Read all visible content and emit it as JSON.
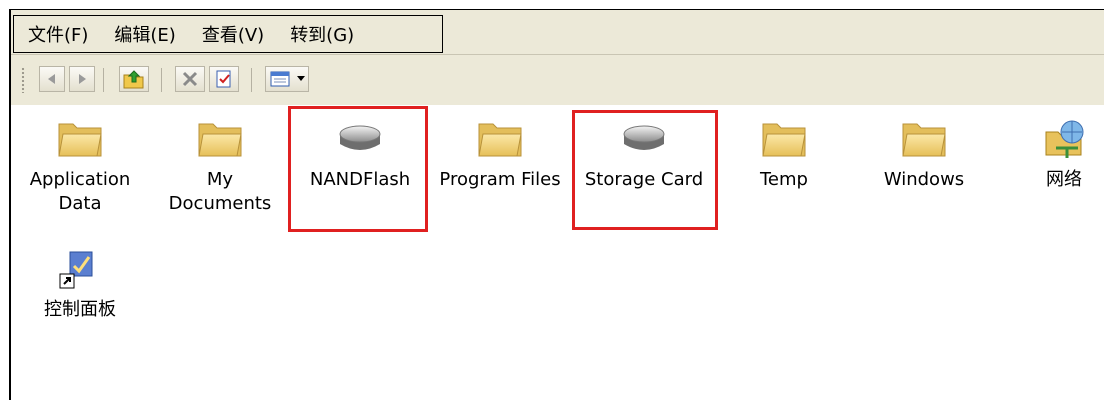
{
  "menu": {
    "file": "文件(F)",
    "edit": "编辑(E)",
    "view": "查看(V)",
    "goto": "转到(G)"
  },
  "toolbar": {
    "icons": [
      "back-icon",
      "forward-icon",
      "up-folder-icon",
      "delete-icon",
      "properties-icon",
      "view-mode-icon",
      "dropdown-arrow-icon"
    ]
  },
  "items": [
    {
      "name": "Application Data",
      "line1": "Application",
      "line2": "Data",
      "icon": "folder-icon"
    },
    {
      "name": "My Documents",
      "line1": "My",
      "line2": "Documents",
      "icon": "folder-icon"
    },
    {
      "name": "NANDFlash",
      "line1": "NANDFlash",
      "line2": "",
      "icon": "drive-icon",
      "highlighted": true
    },
    {
      "name": "Program Files",
      "line1": "Program Files",
      "line2": "",
      "icon": "folder-icon"
    },
    {
      "name": "Storage Card",
      "line1": "Storage Card",
      "line2": "",
      "icon": "drive-icon",
      "highlighted": true
    },
    {
      "name": "Temp",
      "line1": "Temp",
      "line2": "",
      "icon": "folder-icon"
    },
    {
      "name": "Windows",
      "line1": "Windows",
      "line2": "",
      "icon": "folder-icon"
    },
    {
      "name": "网络",
      "line1": "网络",
      "line2": "",
      "icon": "network-icon"
    },
    {
      "name": "控制面板",
      "line1": "控制面板",
      "line2": "",
      "icon": "control-panel-shortcut-icon"
    }
  ],
  "colors": {
    "highlight": "#e02020",
    "chrome": "#ece9d8",
    "folder": "#f3d77a"
  }
}
